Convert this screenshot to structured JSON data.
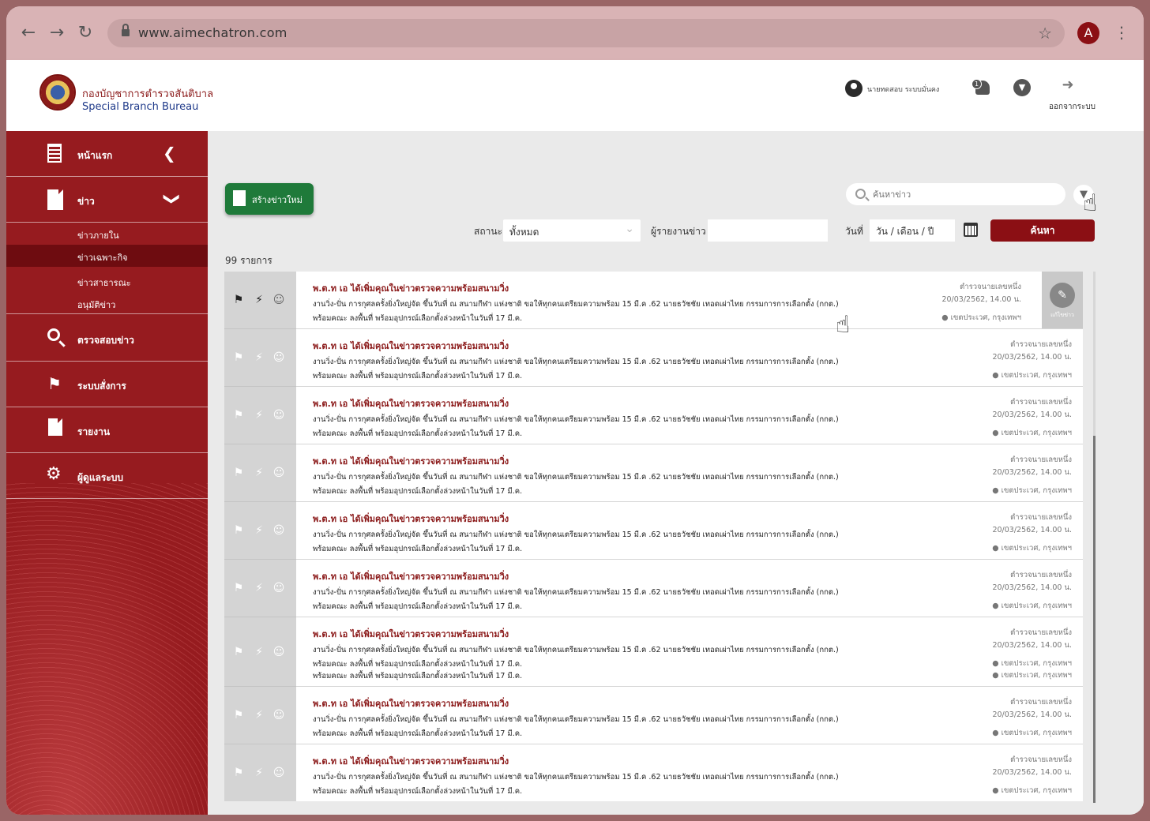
{
  "browser": {
    "url": "www.aimechatron.com",
    "profile_initial": "A"
  },
  "header": {
    "org_th": "กองบัญชาการตำรวจสันติบาล",
    "org_en": "Special Branch Bureau",
    "user_name": "นายทดสอบ ระบบมั่นคง",
    "notification_count": "1",
    "logout_label": "ออกจากระบบ"
  },
  "sidebar": {
    "home": "หน้าแรก",
    "news": "ข่าว",
    "news_sub": [
      "ข่าวภายใน",
      "ข่าวเฉพาะกิจ",
      "ข่าวสาธารณะ",
      "อนุมัติข่าว"
    ],
    "active_sub": 1,
    "check": "ตรวจสอบข่าว",
    "command": "ระบบสั่งการ",
    "report": "รายงาน",
    "admin": "ผู้ดูแลระบบ"
  },
  "toolbar": {
    "create_label": "สร้างข่าวใหม่",
    "search_placeholder": "ค้นหาข่าว",
    "status_label": "สถานะ",
    "status_value": "ทั้งหมด",
    "reporter_label": "ผู้รายงานข่าว",
    "reporter_value": "",
    "date_label": "วันที่",
    "date_placeholder": "วัน / เดือน / ปี",
    "search_button": "ค้นหา",
    "count_label": "99 รายการ"
  },
  "news_list": {
    "title": "พ.ต.ท เอ ได้เพิ่มคุณในข่าวตรวจความพร้อมสนามวิ่ง",
    "line1": "งานวิ่ง-ปั่น การกุศลครั้งยิ่งใหญ่จัด ขึ้นวันที่ ณ สนามกีฬา แห่งชาติ ขอให้ทุกคนเตรียมความพร้อม 15 มี.ค .62 นายธวัชชัย เทอดเผ่าไทย กรรมการการเลือกตั้ง (กกต.)",
    "line2": "พร้อมคณะ ลงพื้นที่ พร้อมอุปกรณ์เลือกตั้งล่วงหน้าในวันที่ 17 มี.ค.",
    "reporter": "ตำรวจนายเลขหนึ่ง",
    "datetime": "20/03/2562, 14.00 น.",
    "location": "เขตประเวศ, กรุงเทพฯ",
    "edit_label": "แก้ไขข่าว"
  },
  "icons": {
    "flag": "flag-icon",
    "bolt": "bolt-icon",
    "assign": "user-check-icon",
    "edit": "edit-icon"
  },
  "colors": {
    "brand": "#961b1f",
    "brand_dark": "#6e0c10",
    "create": "#1f7a3a",
    "search_button": "#8b0f14",
    "title_text": "#8b1a1a"
  }
}
